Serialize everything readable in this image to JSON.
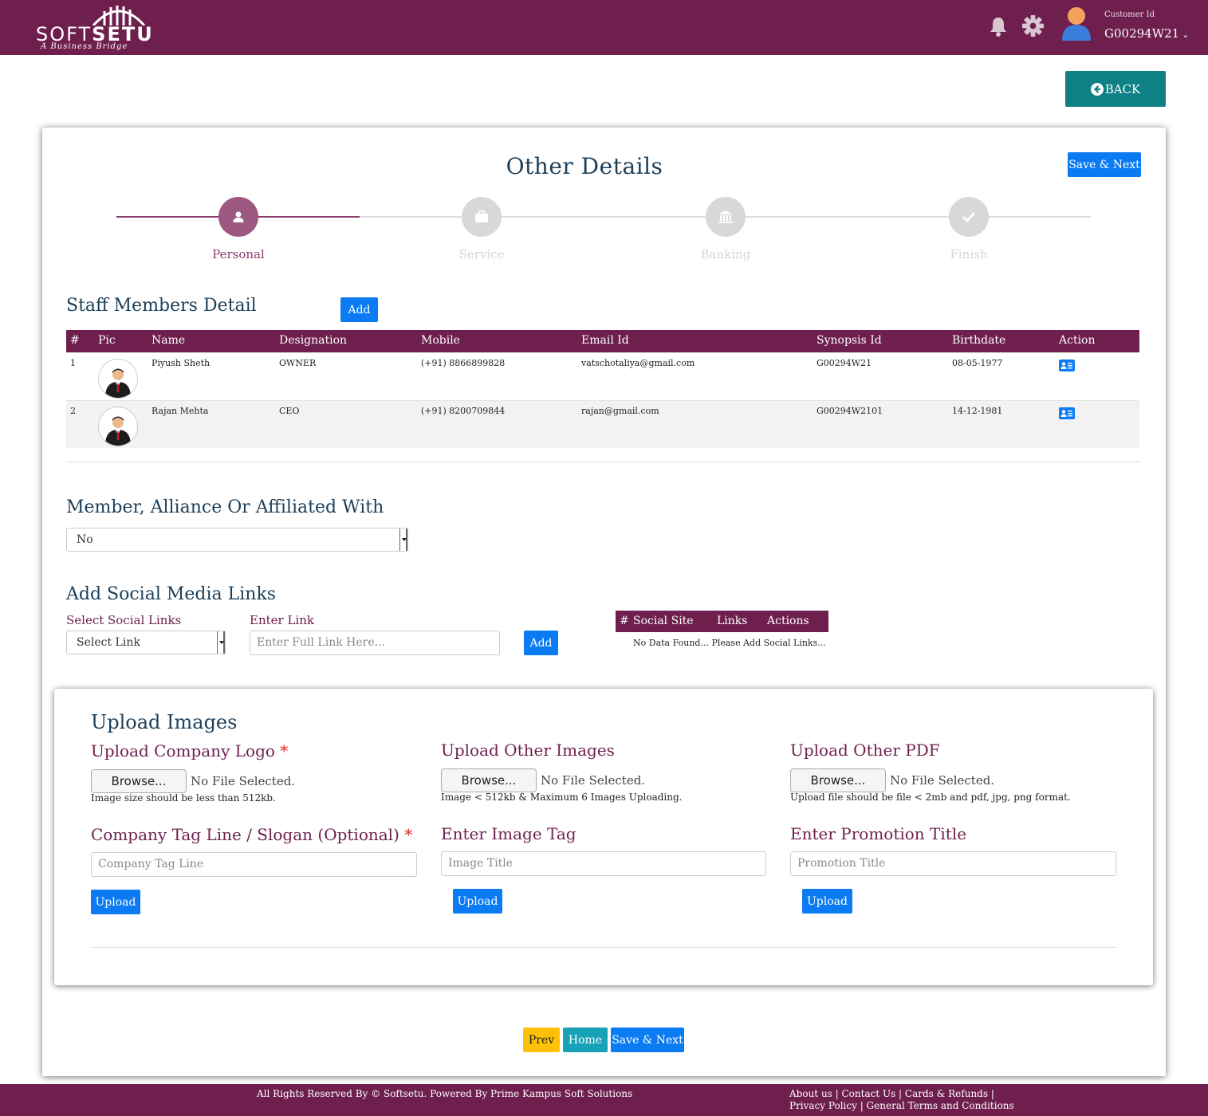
{
  "header": {
    "logo_soft": "SOFT",
    "logo_setu": "SETU",
    "logo_tagline": "A Business Bridge",
    "customer_label": "Customer Id",
    "customer_id": "G00294W21"
  },
  "back_label": "BACK",
  "page": {
    "title": "Other Details",
    "save_next_label": "Save & Next"
  },
  "stepper": {
    "steps": [
      {
        "label": "Personal",
        "icon": "user-icon",
        "active": true
      },
      {
        "label": "Service",
        "icon": "briefcase-icon",
        "active": false
      },
      {
        "label": "Banking",
        "icon": "bank-icon",
        "active": false
      },
      {
        "label": "Finish",
        "icon": "check-icon",
        "active": false
      }
    ]
  },
  "staff": {
    "title": "Staff Members Detail",
    "add_label": "Add",
    "columns": [
      "#",
      "Pic",
      "Name",
      "Designation",
      "Mobile",
      "Email Id",
      "Synopsis Id",
      "Birthdate",
      "Action"
    ],
    "rows": [
      {
        "num": "1",
        "name": "Piyush Sheth",
        "designation": "OWNER",
        "mobile": "(+91) 8866899828",
        "email": "vatschotaliya@gmail.com",
        "synopsis": "G00294W21",
        "birthdate": "08-05-1977"
      },
      {
        "num": "2",
        "name": "Rajan Mehta",
        "designation": "CEO",
        "mobile": "(+91) 8200709844",
        "email": "rajan@gmail.com",
        "synopsis": "G00294W2101",
        "birthdate": "14-12-1981"
      }
    ]
  },
  "affiliation": {
    "title": "Member, Alliance Or Affiliated With",
    "selected": "No"
  },
  "social": {
    "title": "Add Social Media Links",
    "select_label": "Select Social Links",
    "select_value": "Select Link",
    "link_label": "Enter Link",
    "link_placeholder": "Enter Full Link Here...",
    "add_label": "Add",
    "table_columns": [
      "#",
      "Social Site",
      "Links",
      "Actions"
    ],
    "empty_text": "No Data Found... Please Add Social Links..."
  },
  "upload": {
    "title": "Upload Images",
    "logo_label": "Upload Company Logo",
    "logo_hint": "Image size should be less than 512kb.",
    "other_images_label": "Upload Other Images",
    "other_images_hint": "Image < 512kb & Maximum 6 Images Uploading.",
    "pdf_label": "Upload Other PDF",
    "pdf_hint": "Upload file should be file < 2mb and pdf, jpg, png format.",
    "browse_label": "Browse...",
    "no_file": "No File Selected.",
    "tagline_label": "Company Tag Line / Slogan (Optional)",
    "tagline_placeholder": "Company Tag Line",
    "image_tag_label": "Enter Image Tag",
    "image_tag_placeholder": "Image Title",
    "promo_label": "Enter Promotion Title",
    "promo_placeholder": "Promotion Title",
    "upload_label": "Upload",
    "required_mark": "*"
  },
  "nav": {
    "prev": "Prev",
    "home": "Home",
    "save_next": "Save & Next"
  },
  "footer": {
    "copyright": "All Rights Reserved By © Softsetu. Powered By Prime Kampus Soft Solutions",
    "links": "About us | Contact Us | Cards & Refunds | Privacy Policy | General Terms and Conditions"
  },
  "colors": {
    "brand": "#6e1f4d",
    "primary": "#0a7bf3",
    "teal": "#0d8185",
    "warning": "#ffc107",
    "info": "#17a2b8"
  }
}
